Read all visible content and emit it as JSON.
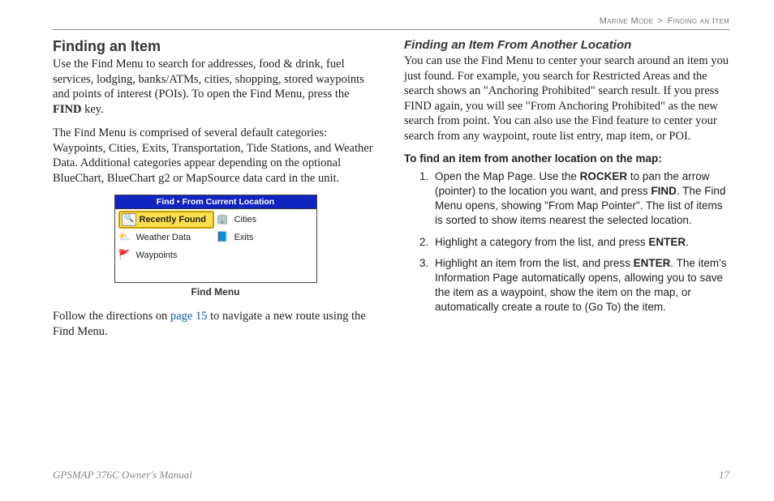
{
  "breadcrumb": {
    "section": "Marine Mode",
    "sep": ">",
    "page": "Finding an Item"
  },
  "left": {
    "heading": "Finding an Item",
    "p1a": "Use the Find Menu to search for addresses, food & drink, fuel services, lodging, banks/ATMs, cities, shopping, stored waypoints and points of interest (POIs). To open the Find Menu, press the ",
    "p1b": "FIND",
    "p1c": " key.",
    "p2": "The Find Menu is comprised of several default categories: Waypoints, Cities, Exits, Transportation, Tide Stations, and Weather Data. Additional categories appear depending on the optional BlueChart, BlueChart g2 or MapSource data card in the unit.",
    "findmenu": {
      "title": "Find • From Current Location",
      "items": {
        "recent": "Recently Found",
        "cities": "Cities",
        "weather": "Weather Data",
        "exits": "Exits",
        "waypoints": "Waypoints"
      },
      "caption": "Find Menu"
    },
    "p3a": "Follow the directions on ",
    "p3link": "page 15",
    "p3b": " to navigate a new route using the Find Menu."
  },
  "right": {
    "heading": "Finding an Item From Another Location",
    "p1": "You can use the Find Menu to center your search around an item you just found. For example, you search for Restricted Areas and the search shows an \"Anchoring Prohibited\" search result. If you press FIND again, you will see \"From Anchoring Prohibited\" as the new search from point. You can also use the Find feature to center your search from any waypoint, route list entry, map item, or POI.",
    "stepsTitle": "To find an item from another location on the map:",
    "steps": {
      "s1a": "Open the Map Page. Use the ",
      "s1b": "ROCKER",
      "s1c": " to pan the arrow (pointer) to the location you want, and press ",
      "s1d": "FIND",
      "s1e": ". The Find Menu opens, showing \"From Map Pointer\". The list of items is sorted to show items nearest the selected location.",
      "s2a": "Highlight a category from the list, and press ",
      "s2b": "ENTER",
      "s2c": ".",
      "s3a": "Highlight an item from the list, and press ",
      "s3b": "ENTER",
      "s3c": ". The item's Information Page automatically opens, allowing you to save the item as a waypoint, show the item on the map, or automatically create a route to (Go To) the item."
    }
  },
  "footer": {
    "left": "GPSMAP 376C Owner's Manual",
    "right": "17"
  }
}
